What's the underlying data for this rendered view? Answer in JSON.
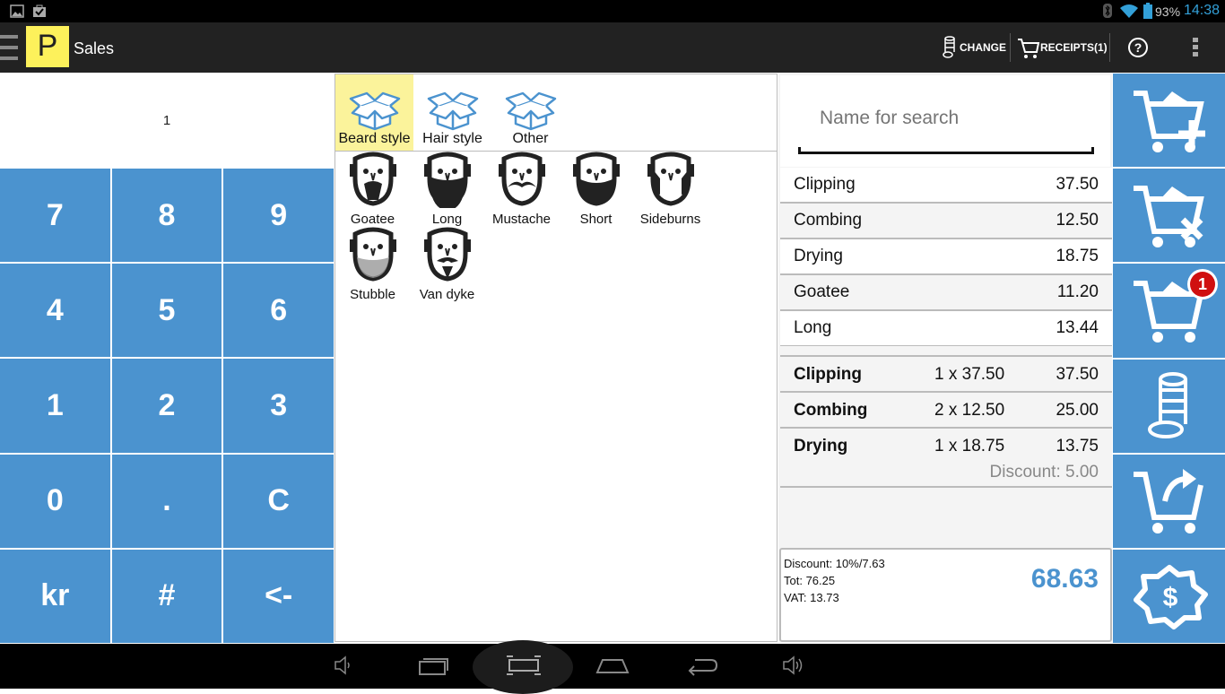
{
  "status": {
    "battery": "93%",
    "time": "14:38"
  },
  "actionbar": {
    "logo": "P",
    "title": "Sales",
    "change": "CHANGE",
    "receipts": "RECEIPTS(1)"
  },
  "display": {
    "value": "1"
  },
  "keypad": [
    "7",
    "8",
    "9",
    "4",
    "5",
    "6",
    "1",
    "2",
    "3",
    "0",
    ".",
    "C",
    "kr",
    "#",
    "<-"
  ],
  "categories": [
    {
      "label": "Beard style",
      "selected": true
    },
    {
      "label": "Hair style",
      "selected": false
    },
    {
      "label": "Other",
      "selected": false
    }
  ],
  "products": [
    "Goatee",
    "Long",
    "Mustache",
    "Short",
    "Sideburns",
    "Stubble",
    "Van dyke"
  ],
  "search": {
    "placeholder": "Name for search"
  },
  "items": [
    {
      "name": "Clipping",
      "price": "37.50"
    },
    {
      "name": "Combing",
      "price": "12.50"
    },
    {
      "name": "Drying",
      "price": "18.75"
    },
    {
      "name": "Goatee",
      "price": "11.20"
    },
    {
      "name": "Long",
      "price": "13.44"
    }
  ],
  "receipt": [
    {
      "name": "Clipping",
      "qty": "1 x 37.50",
      "total": "37.50"
    },
    {
      "name": "Combing",
      "qty": "2 x 12.50",
      "total": "25.00"
    },
    {
      "name": "Drying",
      "qty": "1 x 18.75",
      "total": "13.75",
      "discount": "Discount: 5.00"
    }
  ],
  "totals": {
    "discount": "Discount: 10%/7.63",
    "tot": "Tot: 76.25",
    "vat": "VAT: 13.73",
    "grand": "68.63"
  },
  "actions": {
    "badge": "1"
  },
  "colors": {
    "accent": "#4b93cf",
    "logo": "#fdf15b",
    "selected": "#fbf39b"
  }
}
